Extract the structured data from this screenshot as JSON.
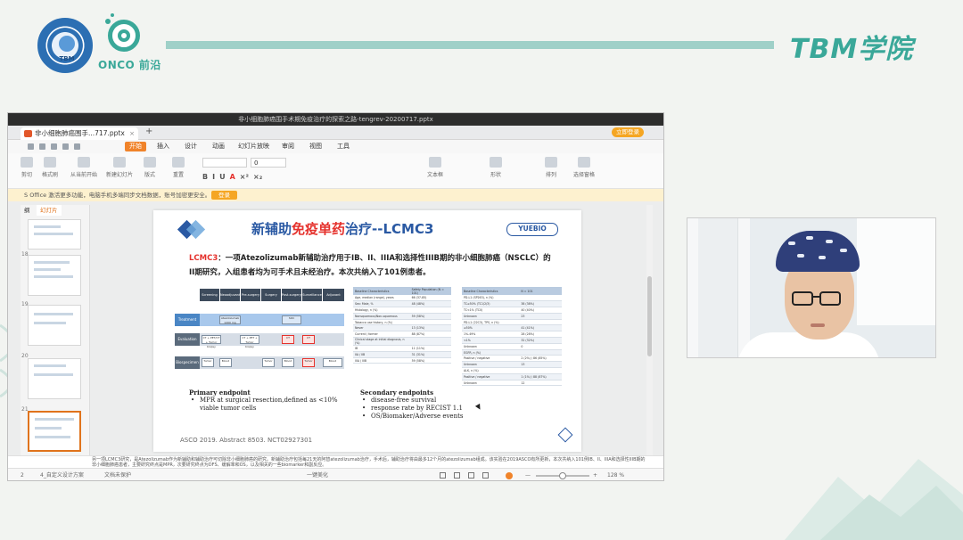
{
  "branding": {
    "seal_text": "TBM",
    "onco_text": "ONCO 前沿",
    "tbm_title": "TBM学院"
  },
  "window": {
    "title": "非小细胞肺癌围手术期免疫治疗的探索之路-tengrev-20200717.pptx",
    "tab_label": "非小细胞肺癌围手...717.pptx",
    "new_tab": "+",
    "login_label": "立即登录"
  },
  "menu": {
    "items": [
      "开始",
      "插入",
      "设计",
      "动画",
      "幻灯片放映",
      "审阅",
      "视图",
      "工具"
    ]
  },
  "toolbar": {
    "tools": [
      {
        "label": "剪切",
        "icon": "cut-icon"
      },
      {
        "label": "格式刷",
        "icon": "format-painter-icon"
      },
      {
        "label": "从当前开始",
        "icon": "play-icon"
      },
      {
        "label": "新建幻灯片",
        "icon": "new-slide-icon"
      },
      {
        "label": "版式",
        "icon": "layout-icon"
      },
      {
        "label": "重置",
        "icon": "reset-icon"
      }
    ],
    "font_size": "0",
    "format_buttons": [
      "B",
      "I",
      "U",
      "A",
      "×²",
      "×₂"
    ],
    "right_tools": [
      {
        "label": "文本框",
        "icon": "textbox-icon"
      },
      {
        "label": "形状",
        "icon": "shape-icon"
      },
      {
        "label": "排列",
        "icon": "arrange-icon"
      },
      {
        "label": "选择窗格",
        "icon": "selection-pane-icon"
      }
    ]
  },
  "notice": {
    "text": "S Office 激活更多功能，电脑手机多端同步文档数据，账号加密更安全。",
    "button": "登录"
  },
  "panel": {
    "tabs": [
      "纲",
      "幻灯片"
    ],
    "thumb_numbers": [
      "18",
      "19",
      "20",
      "21"
    ]
  },
  "slide": {
    "title_prefix": "新辅助",
    "title_highlight": "免疫单药",
    "title_suffix": "治疗--LCMC3",
    "logo_text": "YUEBIO",
    "desc_tag": "LCMC3",
    "desc_text": "：一项Atezolizumab新辅助治疗用于IB、II、IIIA和选择性IIIB期的非小细胞肺癌（NSCLC）的II期研究，入组患者均为可手术且未经治疗。本次共纳入了101例患者。",
    "design": {
      "headers": [
        "Screening",
        "Neoadjuvant treatment",
        "Pre-surgery",
        "Surgery",
        "Post-surgery",
        "Surveillance",
        "Adjuvant"
      ],
      "rows": [
        "Treatment",
        "Evaluation",
        "Biospecimen"
      ],
      "boxes": [
        "Atezolizumab 1200 mg",
        "SOC",
        "CT + PET/CT + Tumor biopsy",
        "CT + PET + Tumor biopsy",
        "CT",
        "CT",
        "Tumor",
        "Blood",
        "Tumor",
        "Blood",
        "Tumor",
        "Blood"
      ]
    },
    "table1": {
      "headers": [
        "Baseline Characteristics",
        "Safety Population (N = 101)"
      ],
      "rows": [
        [
          "Age, median (range), years",
          "66 (37-85)"
        ],
        [
          "Sex: Male, %",
          "48 (48%)"
        ],
        [
          "Histology, n (%)",
          ""
        ],
        [
          "Nonsquamous/Non-squamous",
          "59 (58%)"
        ],
        [
          "Tobacco use history, n (%)",
          ""
        ],
        [
          "Never",
          "13 (13%)"
        ],
        [
          "Current / former",
          "88 (87%)"
        ],
        [
          "Clinical stage at initial diagnosis, n (%)",
          ""
        ],
        [
          "IB",
          "11 (11%)"
        ],
        [
          "IIA / IIB",
          "31 (31%)"
        ],
        [
          "IIIA / IIIB",
          "59 (58%)"
        ]
      ]
    },
    "table2": {
      "headers": [
        "Baseline Characteristics",
        "N = 101"
      ],
      "rows": [
        [
          "PD-L1 (SP263), n (%)",
          ""
        ],
        [
          "TC≥50% (TC1/2/3)",
          "38 (38%)"
        ],
        [
          "TC<1% (TC0)",
          "40 (40%)"
        ],
        [
          "Unknown",
          "23"
        ],
        [
          "PD-L1 (22C3), TPS, n (%)",
          ""
        ],
        [
          "≥50%",
          "41 (41%)"
        ],
        [
          "1%-49%",
          "28 (28%)"
        ],
        [
          "<1%",
          "32 (32%)"
        ],
        [
          "Unknown",
          "0"
        ],
        [
          "EGFR, n (%)",
          ""
        ],
        [
          "Positive / negative",
          "2 (2%) / 86 (85%)"
        ],
        [
          "Unknown",
          "13"
        ],
        [
          "ALK, n (%)",
          ""
        ],
        [
          "Positive / negative",
          "1 (1%) / 88 (87%)"
        ],
        [
          "Unknown",
          "12"
        ]
      ]
    },
    "primary": {
      "heading": "Primary endpoint",
      "items": [
        "MPR at surgical resection,defined as <10% viable tumor cells"
      ]
    },
    "secondary": {
      "heading": "Secondary endpoints",
      "items": [
        "disease-free survival",
        "response rate by RECIST 1.1",
        "OS/Biomaker/Adverse events"
      ]
    },
    "footer": "ASCO 2019. Abstract 8503. NCT02927301"
  },
  "notes": {
    "text": "另一项LCMC3研究，是Atezolizumab作为新辅助和辅助治疗可切除非小细胞肺癌的研究。新辅助治疗包括每21天的阿替atezolizumab治疗，手术后，辅助治疗将由最多12个月的atezolizumab组成。该实验在2019ASCO有所更新，本次共纳入101例IB、II、IIIA和选择性IIIB期的非小细胞肺癌患者，主要研究终点是MPR，次要研究终点为DFS、缓解率和OS，以及相关的一些biomarker和副反应。"
  },
  "status": {
    "slide_num": "2",
    "theme": "4_自定义设计方案",
    "protect": "文档未保护",
    "beautify": "一键美化",
    "zoom": "128 %",
    "zoom_minus": "—",
    "zoom_plus": "+"
  },
  "colors": {
    "brand_teal": "#3aa899",
    "slide_blue": "#2a59a3",
    "slide_red": "#e5322d",
    "wps_orange": "#f0832a"
  }
}
